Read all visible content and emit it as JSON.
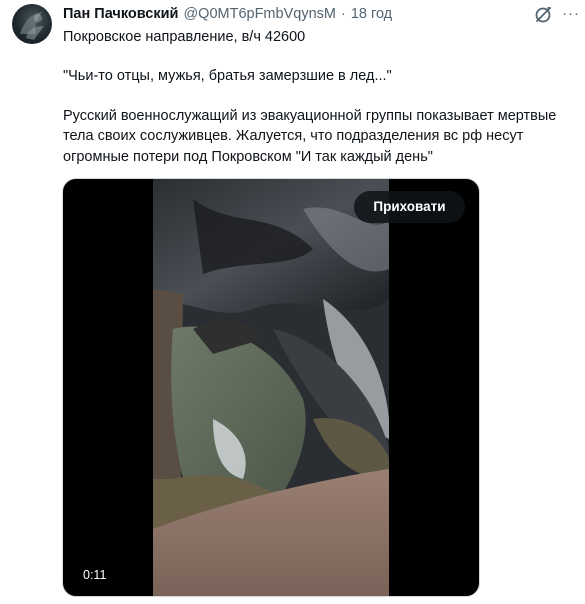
{
  "tweet": {
    "author_name": "Пан Пачковский",
    "handle": "@Q0MT6pFmbVqynsM",
    "separator": "·",
    "time": "18 год",
    "more_label": "···",
    "text_lines": [
      "Покровское направление, в/ч 42600",
      "\"Чьи-то отцы, мужья, братья замерзшие в лед...\"",
      "Русский военнослужащий из эвакуационной группы показывает мертвые",
      "тела своих сослуживцев. Жалуется, что подразделения вс рф несут",
      "огромные потери под Покровском \"И так каждый день\""
    ]
  },
  "media": {
    "hide_label": "Приховати",
    "duration": "0:11"
  },
  "icons": {
    "avatar": "avatar-image",
    "grok": "grok-icon",
    "more": "more-options-icon"
  },
  "colors": {
    "text": "#0f1419",
    "secondary_text": "#536471",
    "media_background": "#000000",
    "hide_button": "#0f1419"
  }
}
